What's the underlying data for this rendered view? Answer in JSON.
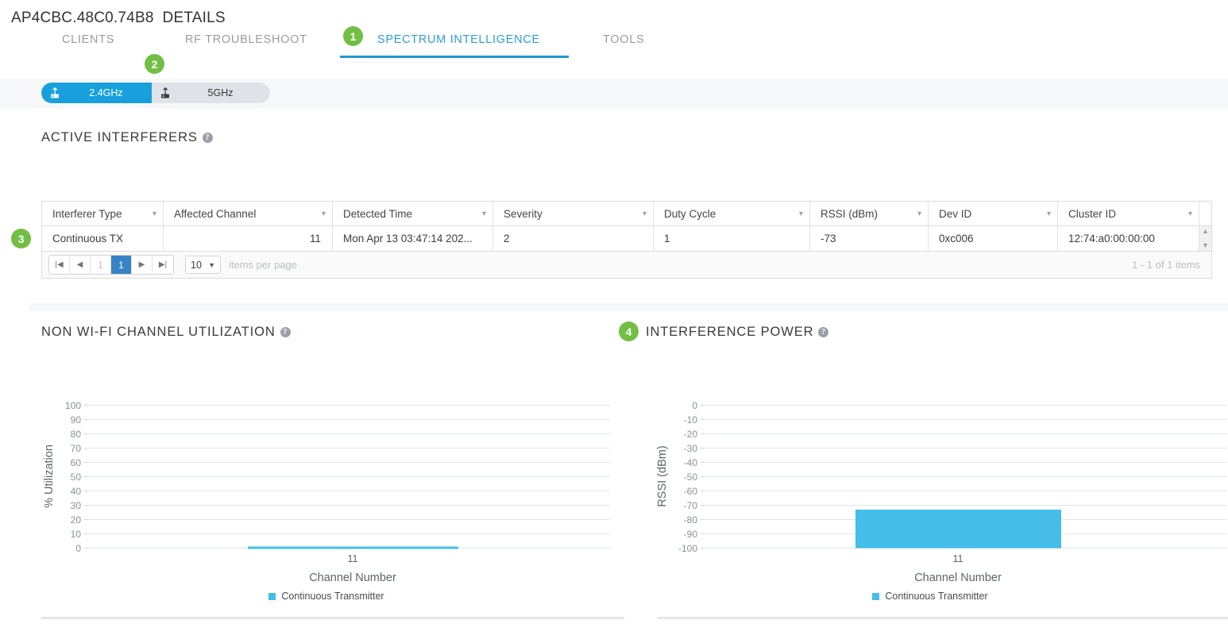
{
  "header": {
    "title": "AP4CBC.48C0.74B8  DETAILS",
    "tabs": [
      {
        "label": "CLIENTS",
        "active": false
      },
      {
        "label": "RF TROUBLESHOOT",
        "active": false
      },
      {
        "label": "SPECTRUM INTELLIGENCE",
        "active": true
      },
      {
        "label": "TOOLS",
        "active": false
      }
    ],
    "active_tab_color": "#2b9fd8"
  },
  "badges": [
    {
      "number": "1"
    },
    {
      "number": "2"
    },
    {
      "number": "3"
    },
    {
      "number": "4"
    }
  ],
  "band_toggle": {
    "selected": "2.4GHz",
    "options": [
      {
        "label": "2.4GHz",
        "selected": true
      },
      {
        "label": "5GHz",
        "selected": false
      }
    ],
    "selected_color": "#17a0db",
    "unselected_color": "#dfe3e8"
  },
  "active_interferers": {
    "title": "ACTIVE INTERFERERS",
    "help": "?",
    "columns": [
      "Interferer Type",
      "Affected Channel",
      "Detected Time",
      "Severity",
      "Duty Cycle",
      "RSSI (dBm)",
      "Dev ID",
      "Cluster ID"
    ],
    "rows": [
      {
        "interferer_type": "Continuous TX",
        "affected_channel": "11",
        "detected_time": "Mon Apr 13 03:47:14 202...",
        "severity": "2",
        "duty_cycle": "1",
        "rssi": "-73",
        "dev_id": "0xc006",
        "cluster_id": "12:74:a0:00:00:00"
      }
    ],
    "pagination": {
      "first": "|◀",
      "prev": "◀",
      "page_input": "1",
      "current_page": "1",
      "next": "▶",
      "last": "▶|",
      "page_size": "10",
      "page_size_caret": "▼",
      "items_per_page_label": "items per page",
      "count_label": "1 - 1 of 1 items"
    }
  },
  "charts": {
    "left": {
      "title": "NON WI-FI CHANNEL UTILIZATION",
      "help": "?",
      "legend": "Continuous Transmitter"
    },
    "right": {
      "title": "INTERFERENCE POWER",
      "help": "?",
      "legend": "Continuous Transmitter"
    }
  },
  "chart_data": [
    {
      "type": "bar",
      "title": "NON WI-FI CHANNEL UTILIZATION",
      "categories": [
        "11"
      ],
      "series": [
        {
          "name": "Continuous Transmitter",
          "values": [
            1
          ],
          "color": "#45bde8"
        }
      ],
      "xlabel": "Channel Number",
      "ylabel": "% Utilization",
      "ylim": [
        0,
        100
      ],
      "yticks": [
        0,
        10,
        20,
        30,
        40,
        50,
        60,
        70,
        80,
        90,
        100
      ],
      "grid": true,
      "legend_position": "bottom"
    },
    {
      "type": "bar",
      "title": "INTERFERENCE POWER",
      "categories": [
        "11"
      ],
      "series": [
        {
          "name": "Continuous Transmitter",
          "values": [
            -73
          ],
          "color": "#45bde8"
        }
      ],
      "xlabel": "Channel Number",
      "ylabel": "RSSI (dBm)",
      "ylim": [
        -100,
        0
      ],
      "yticks": [
        0,
        -10,
        -20,
        -30,
        -40,
        -50,
        -60,
        -70,
        -80,
        -90,
        -100
      ],
      "grid": true,
      "legend_position": "bottom"
    }
  ]
}
